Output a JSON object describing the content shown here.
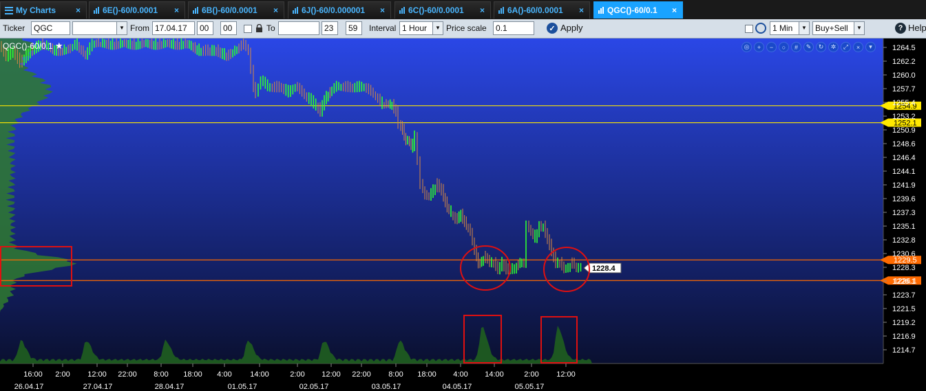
{
  "tabs": [
    {
      "label": "My Charts",
      "close": "×",
      "icon": "menu-icon"
    },
    {
      "label": "6E()-60/0.0001",
      "close": "×",
      "icon": "bar-chart-icon"
    },
    {
      "label": "6B()-60/0.0001",
      "close": "×",
      "icon": "bar-chart-icon"
    },
    {
      "label": "6J()-60/0.000001",
      "close": "×",
      "icon": "bar-chart-icon"
    },
    {
      "label": "6C()-60/0.0001",
      "close": "×",
      "icon": "bar-chart-icon"
    },
    {
      "label": "6A()-60/0.0001",
      "close": "×",
      "icon": "bar-chart-icon"
    },
    {
      "label": "QGC()-60/0.1",
      "close": "×",
      "icon": "bar-chart-icon",
      "active": true
    }
  ],
  "toolbar": {
    "ticker_label": "Ticker",
    "ticker_value": "QGC",
    "from_label": "From",
    "from_date": "17.04.17",
    "from_hour": "00",
    "from_min": "00",
    "to_label": "To",
    "to_date": "",
    "to_hour": "23",
    "to_min": "59",
    "interval_label": "Interval",
    "interval_value": "1 Hour",
    "price_scale_label": "Price scale",
    "price_scale_value": "0.1",
    "apply_label": "Apply",
    "refresh_value": "1 Min",
    "mode_value": "Buy+Sell",
    "help_label": "Help"
  },
  "chart": {
    "title": "QGC()-60/0.1",
    "icons": [
      "zoom-fit-icon",
      "zoom-in-icon",
      "zoom-out-icon",
      "zoom-reset-icon",
      "grid-icon",
      "draw-icon",
      "refresh-icon",
      "settings-icon",
      "maximize-icon",
      "close-icon",
      "dropdown-icon"
    ],
    "colors": {
      "background_top": "#2a47e6",
      "background_bottom": "#0a1030",
      "yellow_level": "#ffe800",
      "orange_level": "#ff6a00",
      "profile_green": "#2f7a2f",
      "annotation_red": "#e01010",
      "candle_up": "#30ff30",
      "candle_down": "#d98a40"
    }
  },
  "chart_data": {
    "type": "candlestick",
    "price_axis_labels": [
      "1264.5",
      "1262.2",
      "1260.0",
      "1257.7",
      "1255.4",
      "1253.2",
      "1250.9",
      "1248.6",
      "1246.4",
      "1244.1",
      "1241.9",
      "1239.6",
      "1237.3",
      "1235.1",
      "1232.8",
      "1230.6",
      "1228.3",
      "1226.1",
      "1223.7",
      "1221.5",
      "1219.2",
      "1216.9",
      "1214.7"
    ],
    "ylim": [
      1213.0,
      1266.0
    ],
    "levels": [
      {
        "price": 1254.9,
        "label": "1254.9",
        "color": "yellow"
      },
      {
        "price": 1252.1,
        "label": "1252.1",
        "color": "yellow"
      },
      {
        "price": 1229.5,
        "label": "1229.5",
        "color": "orange"
      },
      {
        "price": 1226.1,
        "label": "1226.1",
        "color": "orange"
      }
    ],
    "last_price": {
      "price": 1228.4,
      "label": "1228.4"
    },
    "time_labels": [
      "16:00",
      "2:00",
      "12:00",
      "22:00",
      "8:00",
      "18:00",
      "4:00",
      "14:00",
      "2:00",
      "12:00",
      "22:00",
      "8:00",
      "18:00",
      "4:00",
      "14:00",
      "2:00",
      "12:00"
    ],
    "date_labels": [
      "26.04.17",
      "27.04.17",
      "28.04.17",
      "01.05.17",
      "02.05.17",
      "03.05.17",
      "04.05.17",
      "05.05.17"
    ],
    "close_path": [
      [
        0,
        1265
      ],
      [
        10,
        1263
      ],
      [
        20,
        1264
      ],
      [
        30,
        1262
      ],
      [
        45,
        1264
      ],
      [
        60,
        1265
      ],
      [
        80,
        1264
      ],
      [
        100,
        1264
      ],
      [
        110,
        1265
      ],
      [
        125,
        1263
      ],
      [
        135,
        1265
      ],
      [
        150,
        1265
      ],
      [
        170,
        1265
      ],
      [
        190,
        1265
      ],
      [
        210,
        1265
      ],
      [
        230,
        1265
      ],
      [
        250,
        1265
      ],
      [
        270,
        1265
      ],
      [
        290,
        1264
      ],
      [
        300,
        1264
      ],
      [
        315,
        1264
      ],
      [
        330,
        1263
      ],
      [
        345,
        1264
      ],
      [
        355,
        1265
      ],
      [
        362,
        1264
      ],
      [
        366,
        1261
      ],
      [
        369,
        1258
      ],
      [
        373,
        1257
      ],
      [
        380,
        1259
      ],
      [
        390,
        1258
      ],
      [
        400,
        1258
      ],
      [
        410,
        1258
      ],
      [
        420,
        1257
      ],
      [
        430,
        1258
      ],
      [
        440,
        1257
      ],
      [
        450,
        1256
      ],
      [
        460,
        1255
      ],
      [
        466,
        1254
      ],
      [
        472,
        1256
      ],
      [
        480,
        1257
      ],
      [
        490,
        1258
      ],
      [
        500,
        1258
      ],
      [
        510,
        1258
      ],
      [
        520,
        1258
      ],
      [
        530,
        1258
      ],
      [
        540,
        1257
      ],
      [
        550,
        1256
      ],
      [
        556,
        1255
      ],
      [
        562,
        1255
      ],
      [
        570,
        1255
      ],
      [
        576,
        1254
      ],
      [
        580,
        1252
      ],
      [
        585,
        1251
      ],
      [
        590,
        1249
      ],
      [
        595,
        1249
      ],
      [
        600,
        1248
      ],
      [
        604,
        1250
      ],
      [
        608,
        1246
      ],
      [
        612,
        1242
      ],
      [
        618,
        1240
      ],
      [
        624,
        1240
      ],
      [
        630,
        1241
      ],
      [
        636,
        1242
      ],
      [
        642,
        1241
      ],
      [
        650,
        1238
      ],
      [
        656,
        1237
      ],
      [
        662,
        1236
      ],
      [
        670,
        1237
      ],
      [
        678,
        1235
      ],
      [
        684,
        1234
      ],
      [
        690,
        1231
      ],
      [
        695,
        1229
      ],
      [
        700,
        1229
      ],
      [
        706,
        1230
      ],
      [
        712,
        1229
      ],
      [
        718,
        1229
      ],
      [
        724,
        1228
      ],
      [
        730,
        1229
      ],
      [
        736,
        1228
      ],
      [
        742,
        1228
      ],
      [
        748,
        1228
      ],
      [
        756,
        1229
      ],
      [
        762,
        1229
      ],
      [
        766,
        1235
      ],
      [
        772,
        1234
      ],
      [
        778,
        1233
      ],
      [
        784,
        1235
      ],
      [
        790,
        1235
      ],
      [
        796,
        1233
      ],
      [
        802,
        1231
      ],
      [
        808,
        1229
      ],
      [
        814,
        1229
      ],
      [
        820,
        1228
      ],
      [
        826,
        1228
      ],
      [
        832,
        1229
      ],
      [
        838,
        1228
      ],
      [
        845,
        1228
      ]
    ],
    "volume_profile_peak_price": 1229.0,
    "volume_histogram_peaks_x": [
      30,
      125,
      240,
      360,
      470,
      580,
      700,
      810
    ]
  }
}
